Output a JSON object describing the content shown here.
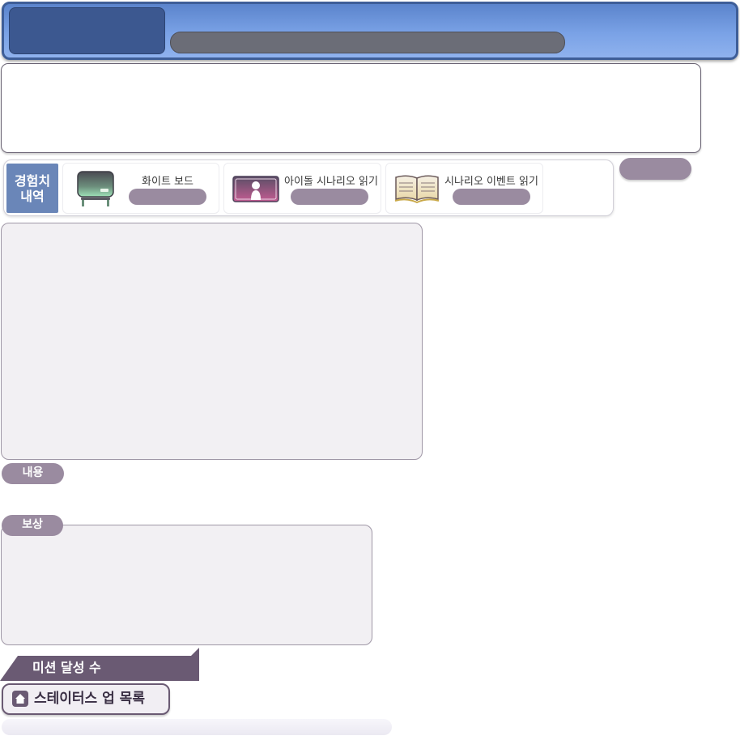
{
  "experience": {
    "title_line1": "경험치",
    "title_line2": "내역",
    "items": [
      {
        "label": "화이트 보드",
        "icon": "whiteboard-icon"
      },
      {
        "label": "아이돌 시나리오 읽기",
        "icon": "idol-scenario-icon"
      },
      {
        "label": "시나리오 이벤트 읽기",
        "icon": "open-book-icon"
      }
    ]
  },
  "sections": {
    "content_label": "내용",
    "reward_label": "보상",
    "mission_count_label": "미션 달성 수",
    "status_list_label": "스테이터스 업 목록"
  },
  "colors": {
    "header_blue": "#6f98e0",
    "header_dark": "#3c5890",
    "pill_mauve": "#9a8ba0",
    "dark_purple": "#6a5a73",
    "panel_bg": "#f2f0f3",
    "exp_title_blue": "#6a86b8"
  }
}
